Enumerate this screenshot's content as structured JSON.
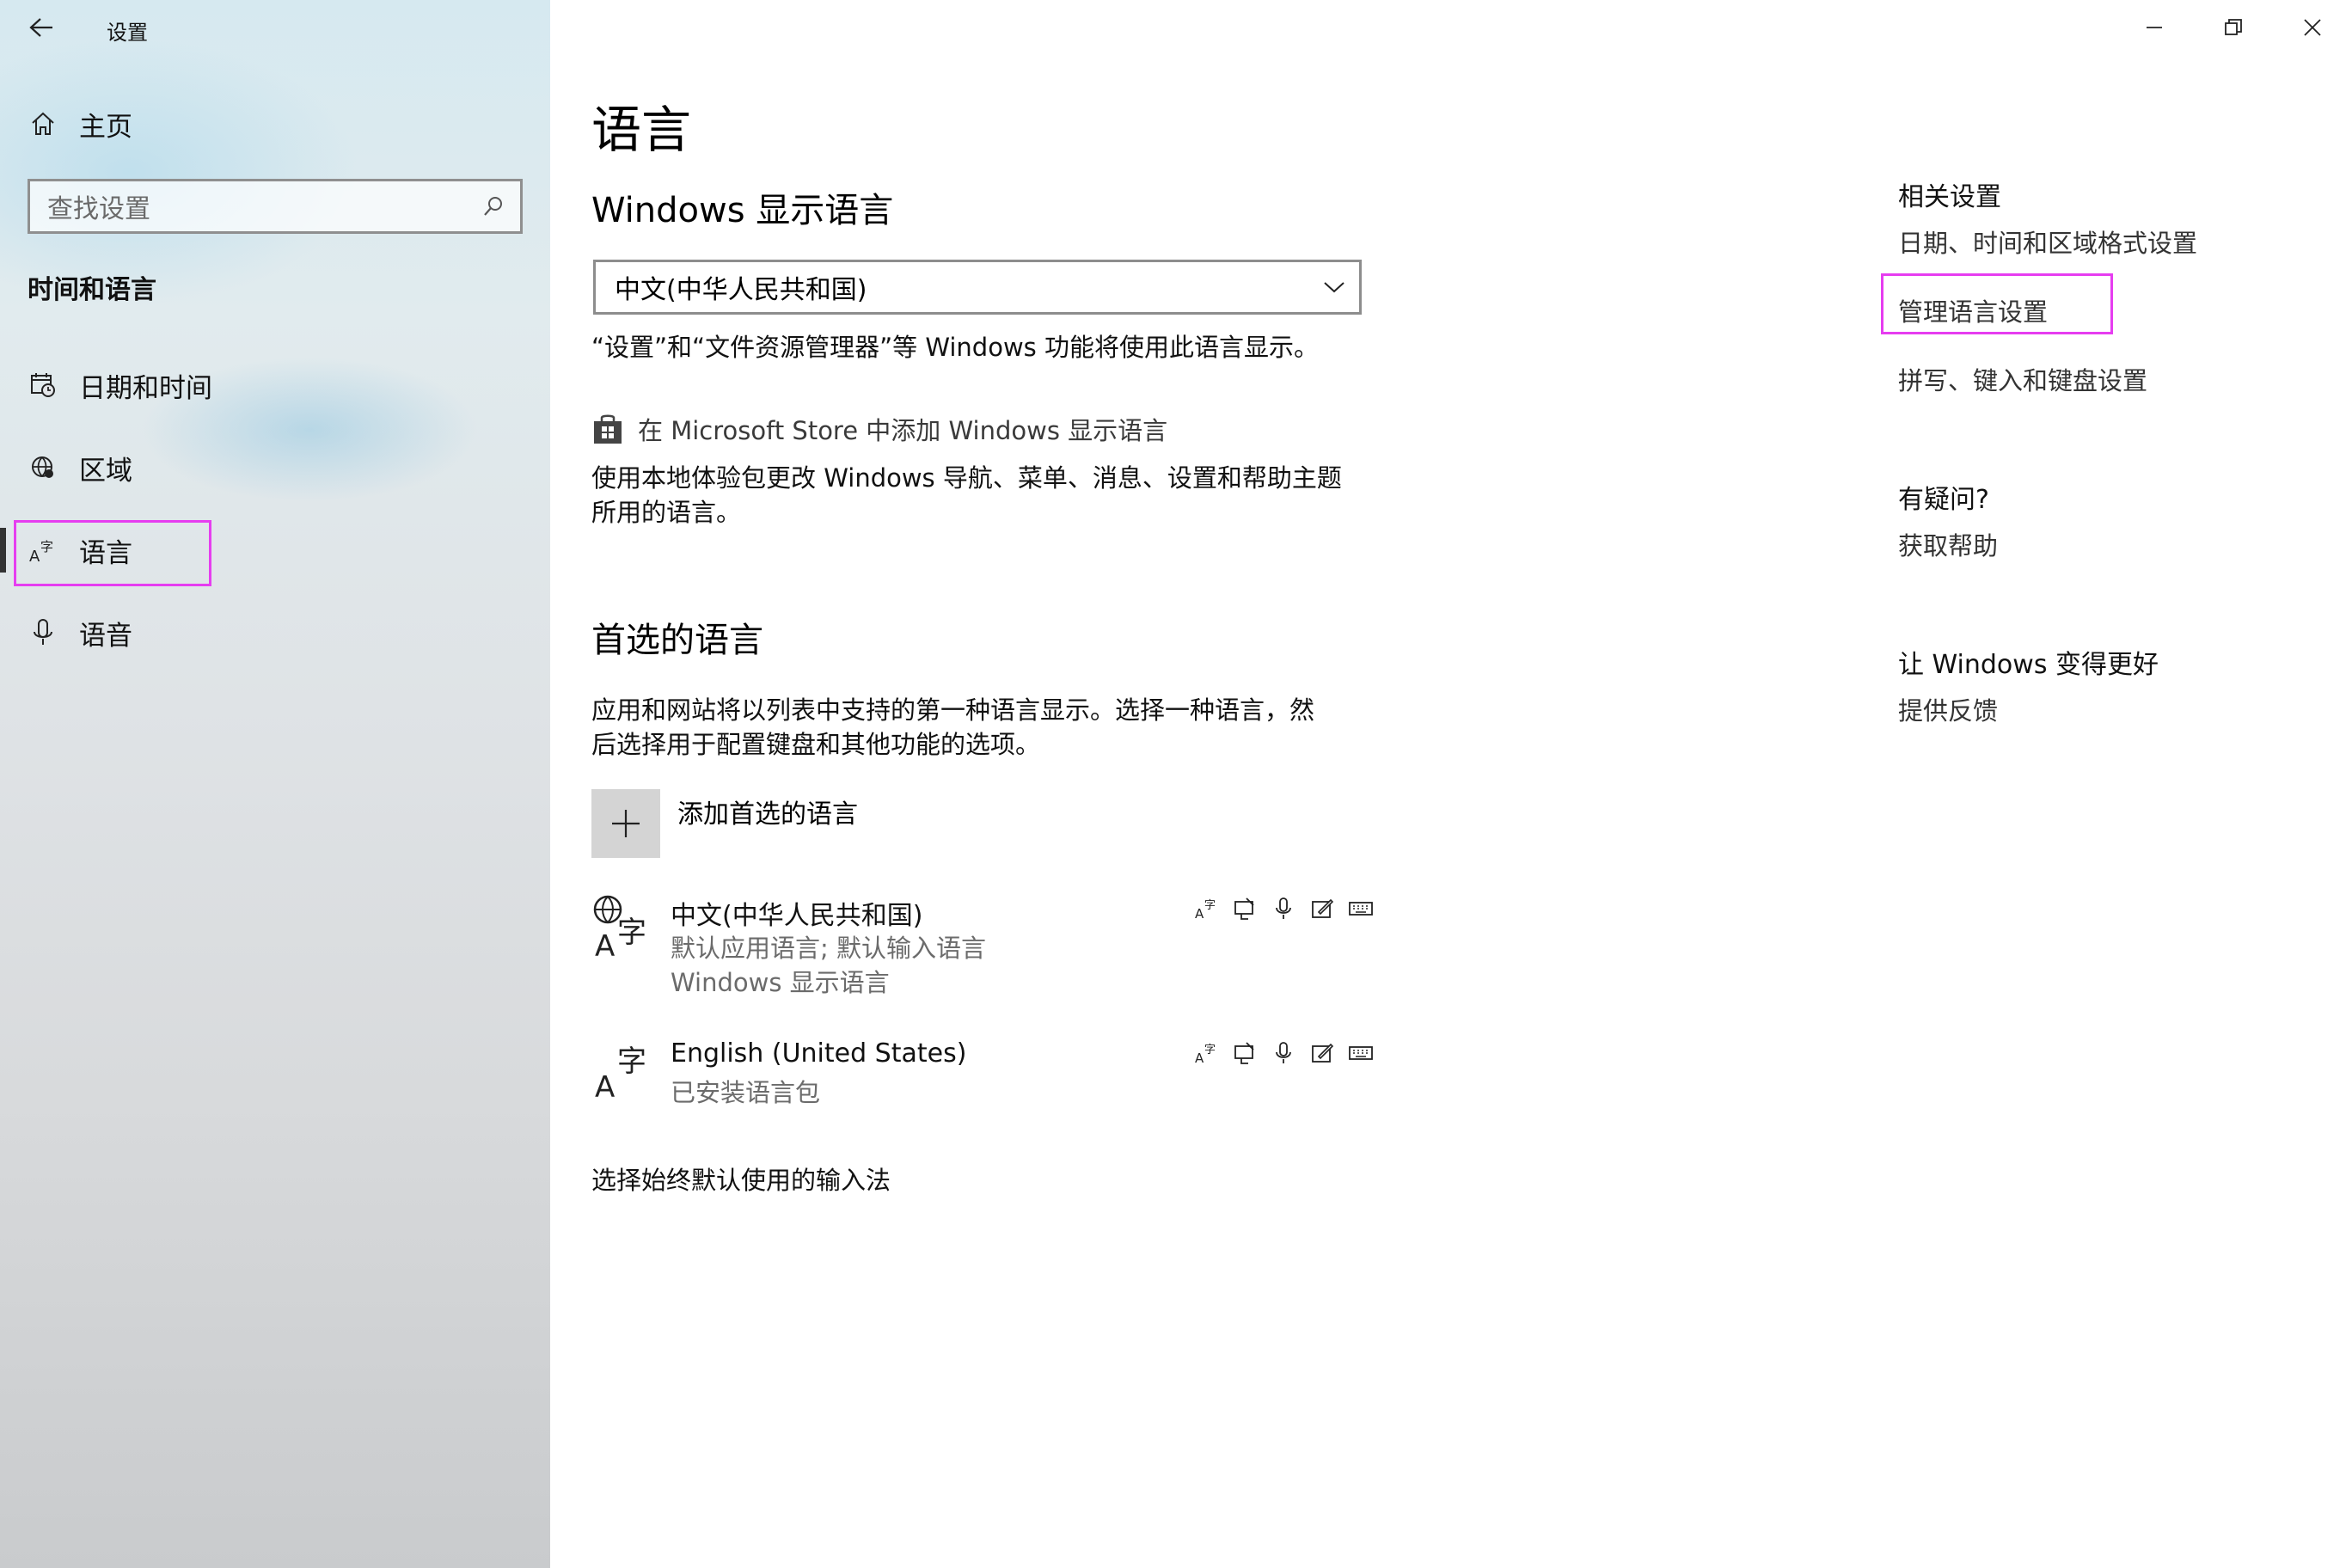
{
  "window": {
    "title": "设置"
  },
  "sidebar": {
    "home": "主页",
    "search_placeholder": "查找设置",
    "section_title": "时间和语言",
    "items": [
      {
        "label": "日期和时间",
        "icon": "calendar-clock-icon"
      },
      {
        "label": "区域",
        "icon": "globe-region-icon"
      },
      {
        "label": "语言",
        "icon": "language-icon",
        "active": true
      },
      {
        "label": "语音",
        "icon": "microphone-icon"
      }
    ]
  },
  "main": {
    "title": "语言",
    "display_language": {
      "heading": "Windows 显示语言",
      "selected": "中文(中华人民共和国)",
      "description": "“设置”和“文件资源管理器”等 Windows 功能将使用此语言显示。",
      "store_link": "在 Microsoft Store 中添加 Windows 显示语言",
      "store_description_line1": "使用本地体验包更改 Windows 导航、菜单、消息、设置和帮助主题",
      "store_description_line2": "所用的语言。"
    },
    "preferred": {
      "heading": "首选的语言",
      "description_line1": "应用和网站将以列表中支持的第一种语言显示。选择一种语言，然",
      "description_line2": "后选择用于配置键盘和其他功能的选项。",
      "add_label": "添加首选的语言",
      "languages": [
        {
          "name": "中文(中华人民共和国)",
          "line1": "默认应用语言; 默认输入语言",
          "line2": "Windows 显示语言"
        },
        {
          "name": "English (United States)",
          "line1": "已安装语言包"
        }
      ]
    },
    "ime_link": "选择始终默认使用的输入法"
  },
  "related": {
    "heading": "相关设置",
    "links": [
      "日期、时间和区域格式设置",
      "管理语言设置",
      "拼写、键入和键盘设置"
    ],
    "help_heading": "有疑问?",
    "help_link": "获取帮助",
    "feedback_heading": "让 Windows 变得更好",
    "feedback_link": "提供反馈"
  },
  "colors": {
    "highlight": "#e63df0",
    "active_indicator": "#333333"
  }
}
